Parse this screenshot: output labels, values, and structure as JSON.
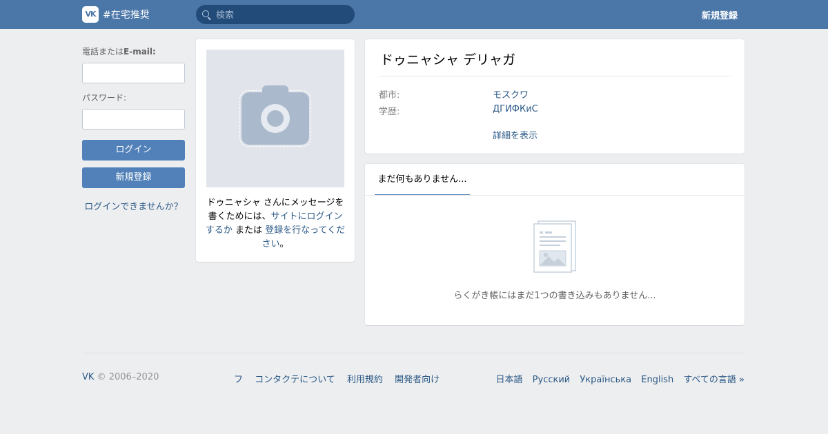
{
  "header": {
    "logo_text": "VK",
    "hashtag": "#在宅推奨",
    "search_placeholder": "検索",
    "signup_label": "新規登録"
  },
  "login": {
    "phone_label": "電話または",
    "phone_label_bold": "E-mail:",
    "password_label": "パスワード:",
    "login_button": "ログイン",
    "signup_button": "新規登録",
    "forgot_link": "ログインできませんか？"
  },
  "photo_card": {
    "message_prefix": "ドゥニャシャ さんにメッセージを書くためには、",
    "login_link": "サイトにログインするか",
    "or": " または ",
    "signup_link": "登録を行なってください",
    "suffix": "。"
  },
  "profile": {
    "name": "ドゥニャシャ デリャガ",
    "rows": [
      {
        "label": "都市:",
        "value": "モスクワ"
      },
      {
        "label": "学歴:",
        "value": "ДГИФКиС"
      }
    ],
    "details_link": "詳細を表示"
  },
  "wall": {
    "tab_label": "まだ何もありません...",
    "empty_text": "らくがき帳にはまだ1つの書き込みもありません..."
  },
  "footer": {
    "brand": "VK",
    "copyright": "© 2006–2020",
    "links": [
      "フ",
      "コンタクテについて",
      "利用規約",
      "開発者向け"
    ],
    "languages": [
      "日本語",
      "Русский",
      "Українська",
      "English",
      "すべての言語 »"
    ]
  },
  "colors": {
    "header_bg": "#4a76a8",
    "page_bg": "#edeef0",
    "button_bg": "#5181b8",
    "link": "#2a5885"
  }
}
